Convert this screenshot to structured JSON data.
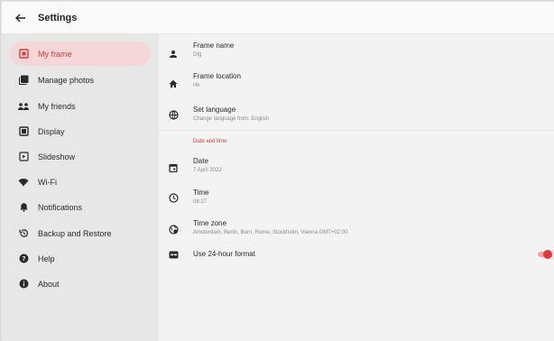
{
  "header": {
    "title": "Settings"
  },
  "sidebar": {
    "items": [
      {
        "label": "My frame",
        "icon": "frame-icon",
        "active": true
      },
      {
        "label": "Manage photos",
        "icon": "photos-icon"
      },
      {
        "label": "My friends",
        "icon": "friends-icon"
      },
      {
        "label": "Display",
        "icon": "display-icon"
      },
      {
        "label": "Slideshow",
        "icon": "slideshow-icon"
      },
      {
        "label": "Wi-Fi",
        "icon": "wifi-icon"
      },
      {
        "label": "Notifications",
        "icon": "notifications-icon"
      },
      {
        "label": "Backup and Restore",
        "icon": "backup-icon"
      },
      {
        "label": "Help",
        "icon": "help-icon"
      },
      {
        "label": "About",
        "icon": "info-icon"
      }
    ]
  },
  "main": {
    "frame_name": {
      "title": "Frame name",
      "value": "Dfg"
    },
    "frame_location": {
      "title": "Frame location",
      "value": "Hk"
    },
    "set_language": {
      "title": "Set language",
      "value": "Change language from: English"
    },
    "section_datetime": "Date and time",
    "date": {
      "title": "Date",
      "value": "7 April 2022"
    },
    "time": {
      "title": "Time",
      "value": "08:27"
    },
    "time_zone": {
      "title": "Time zone",
      "value": "Amsterdam, Berlin, Bern, Rome, Stockholm, Vienna GMT+02:00"
    },
    "format_24h": {
      "title": "Use 24-hour format",
      "enabled": true
    }
  },
  "colors": {
    "accent": "#e53935",
    "active_bg": "#f6d7d7"
  }
}
